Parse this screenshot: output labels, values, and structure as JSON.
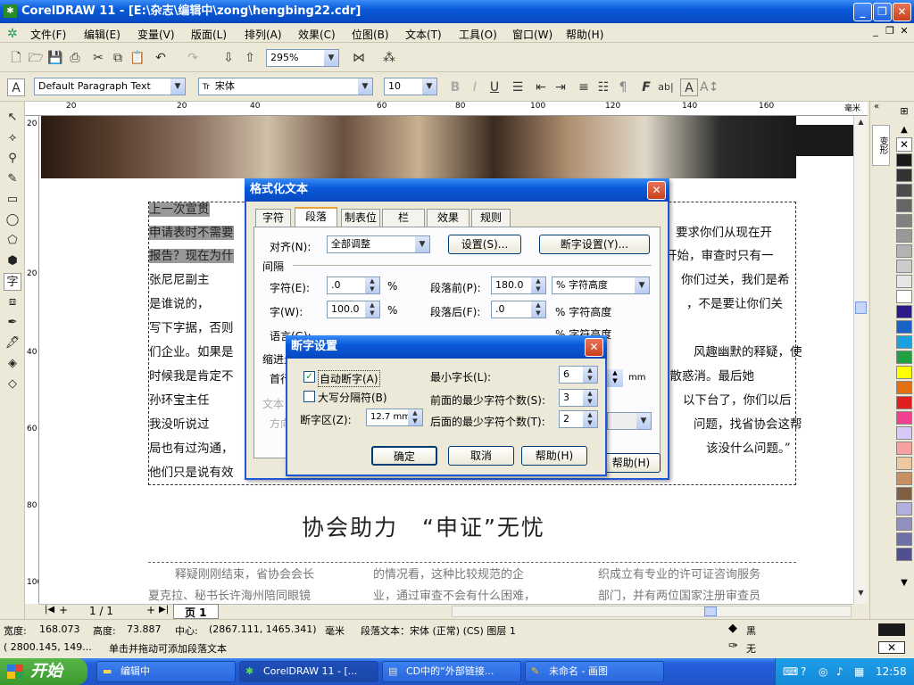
{
  "window": {
    "title": "CorelDRAW 11 - [E:\\杂志\\编辑中\\zong\\hengbing22.cdr]",
    "app_icon": "corel-balloon-icon"
  },
  "menu": [
    "文件(F)",
    "编辑(E)",
    "变量(V)",
    "版面(L)",
    "排列(A)",
    "效果(C)",
    "位图(B)",
    "文本(T)",
    "工具(O)",
    "窗口(W)",
    "帮助(H)"
  ],
  "standard_toolbar": {
    "zoom": "295%"
  },
  "text_toolbar": {
    "style": "Default Paragraph Text",
    "font": "宋体",
    "font_prefix": "Tr",
    "size": "10"
  },
  "rulers": {
    "top_ticks": [
      "20",
      "0",
      "20",
      "40",
      "60",
      "80",
      "100",
      "120",
      "140",
      "160"
    ],
    "unit": "毫米",
    "left_ticks": [
      "20",
      "0",
      "20",
      "40",
      "60",
      "80",
      "100"
    ]
  },
  "document": {
    "lines": [
      "    上一次宣贯",
      "申请表时不需要",
      "报告？现在为什",
      "    张尼尼副主",
      "    是谁说的，",
      "写下字据，否则",
      "们企业。如果是",
      "时候我是肯定不",
      "    孙环宝主任",
      "    我没听说过",
      "局也有过沟通，",
      "他们只是说有效"
    ],
    "right_lines": [
      "要求你们从现在开",
      "开始，审查时只有一",
      "你们过关，我们是希",
      "，不是要让你们关",
      "",
      "风趣幽默的释疑，使",
      "疑散惑消。最后她",
      "以下台了，你们以后",
      "问题，找省协会这帮",
      "该没什么问题。”",
      ""
    ],
    "headline": "协会助力　“申证”无忧",
    "col1": [
      "释疑刚刚结束，省协会会长",
      "夏克拉、秘书长许海州陪同眼镜"
    ],
    "col2": [
      "的情况看，这种比较规范的企",
      "业，通过审查不会有什么困难，"
    ],
    "col3": [
      "织成立有专业的许可证咨询服务",
      "部门，并有两位国家注册审查员"
    ]
  },
  "format_dialog": {
    "title": "格式化文本",
    "tabs": [
      "字符",
      "段落",
      "制表位",
      "栏",
      "效果",
      "规则"
    ],
    "active_tab": "段落",
    "align_label": "对齐(N):",
    "align_value": "全部调整",
    "settings_button": "设置(S)...",
    "hyphen_settings_button": "断字设置(Y)...",
    "spacing_group": "间隔",
    "char_label": "字符(E):",
    "char_value": ".0",
    "word_label": "字(W):",
    "word_value": "100.0",
    "lang_label": "语言(G):",
    "percent": "%",
    "before_para_label": "段落前(P):",
    "before_para_value": "180.0",
    "before_para_unit": "% 字符高度",
    "after_para_label": "段落后(F):",
    "after_para_value": ".0",
    "after_para_unit": "% 字符高度",
    "line_unit": "% 字符高度",
    "indent_group": "缩进量",
    "first_line_label": "首行",
    "mm": "mm",
    "text_dir_group": "文本",
    "dir_label": "方向",
    "help_button": "帮助(H)"
  },
  "hyphen_dialog": {
    "title": "断字设置",
    "auto_hyphen_label": "自动断字(A)",
    "auto_hyphen_checked": true,
    "break_caps_label": "大写分隔符(B)",
    "break_caps_checked": false,
    "hot_zone_label": "断字区(Z):",
    "hot_zone_value": "12.7 mm",
    "min_word_label": "最小字长(L):",
    "min_word_value": "6",
    "min_before_label": "前面的最少字符个数(S):",
    "min_before_value": "3",
    "min_after_label": "后面的最少字符个数(T):",
    "min_after_value": "2",
    "ok": "确定",
    "cancel": "取消",
    "help": "帮助(H)"
  },
  "page_nav": {
    "counter": "1 / 1",
    "tab": "页 1"
  },
  "status": {
    "width_label": "宽度:",
    "width": "168.073",
    "height_label": "高度:",
    "height": "73.887",
    "center_label": "中心:",
    "center": "(2867.111, 1465.341)",
    "unit": "毫米",
    "object": "段落文本：宋体 (正常) (CS) 图层 1",
    "cursor": "( 2800.145, 149...",
    "hint": "单击并拖动可添加段落文本",
    "fill": "黑",
    "outline": "无"
  },
  "palette": [
    "#1a1a1a",
    "#333333",
    "#4d4d4d",
    "#666666",
    "#808080",
    "#999999",
    "#b3b3b3",
    "#cccccc",
    "#e6e6e6",
    "#ffffff",
    "#2b1a8a",
    "#1a64c8",
    "#1aa0e0",
    "#20a040",
    "#ffff00",
    "#e07010",
    "#e02020",
    "#f04090",
    "#d8c8f8",
    "#f8a0a0",
    "#f0c8a0",
    "#c89060",
    "#806040",
    "#b0b0e0",
    "#9090c0",
    "#7070a8",
    "#505090"
  ],
  "taskbar": {
    "start": "开始",
    "tasks": [
      "编辑中",
      "CorelDRAW 11 - [...",
      "CD中的“外部链接...",
      "未命名 - 画图"
    ],
    "clock": "12:58"
  },
  "dockers": {
    "label": "变形"
  }
}
